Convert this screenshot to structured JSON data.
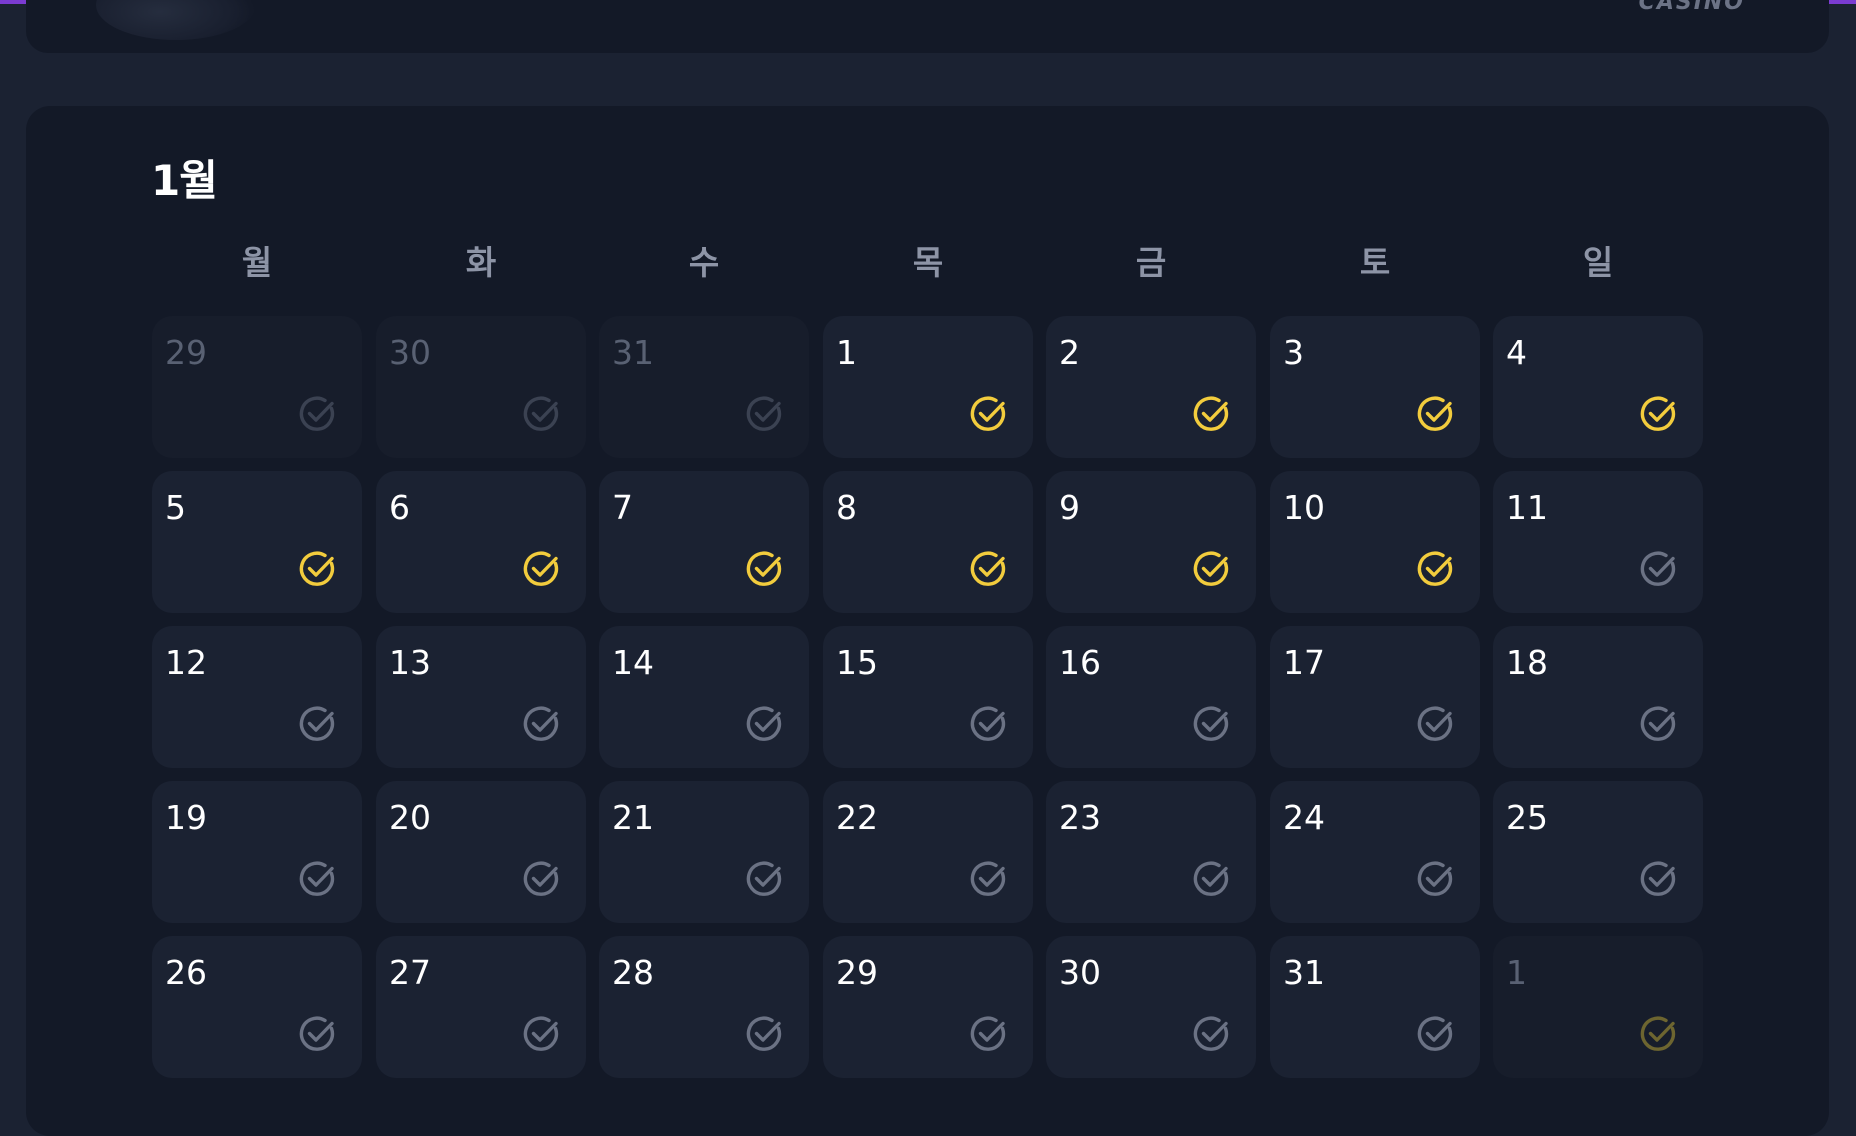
{
  "header": {
    "logo_text": "CASINO"
  },
  "calendar": {
    "month_title": "1월",
    "weekdays": [
      "월",
      "화",
      "수",
      "목",
      "금",
      "토",
      "일"
    ],
    "colors": {
      "checked": "#f2cc3d",
      "unchecked": "#6b7284",
      "muted_checked": "#6d6530",
      "muted_unchecked": "#3b4252"
    },
    "weeks": [
      [
        {
          "day": "29",
          "muted": true,
          "checked": false
        },
        {
          "day": "30",
          "muted": true,
          "checked": false
        },
        {
          "day": "31",
          "muted": true,
          "checked": false
        },
        {
          "day": "1",
          "muted": false,
          "checked": true
        },
        {
          "day": "2",
          "muted": false,
          "checked": true
        },
        {
          "day": "3",
          "muted": false,
          "checked": true
        },
        {
          "day": "4",
          "muted": false,
          "checked": true
        }
      ],
      [
        {
          "day": "5",
          "muted": false,
          "checked": true
        },
        {
          "day": "6",
          "muted": false,
          "checked": true
        },
        {
          "day": "7",
          "muted": false,
          "checked": true
        },
        {
          "day": "8",
          "muted": false,
          "checked": true
        },
        {
          "day": "9",
          "muted": false,
          "checked": true
        },
        {
          "day": "10",
          "muted": false,
          "checked": true
        },
        {
          "day": "11",
          "muted": false,
          "checked": false
        }
      ],
      [
        {
          "day": "12",
          "muted": false,
          "checked": false
        },
        {
          "day": "13",
          "muted": false,
          "checked": false
        },
        {
          "day": "14",
          "muted": false,
          "checked": false
        },
        {
          "day": "15",
          "muted": false,
          "checked": false
        },
        {
          "day": "16",
          "muted": false,
          "checked": false
        },
        {
          "day": "17",
          "muted": false,
          "checked": false
        },
        {
          "day": "18",
          "muted": false,
          "checked": false
        }
      ],
      [
        {
          "day": "19",
          "muted": false,
          "checked": false
        },
        {
          "day": "20",
          "muted": false,
          "checked": false
        },
        {
          "day": "21",
          "muted": false,
          "checked": false
        },
        {
          "day": "22",
          "muted": false,
          "checked": false
        },
        {
          "day": "23",
          "muted": false,
          "checked": false
        },
        {
          "day": "24",
          "muted": false,
          "checked": false
        },
        {
          "day": "25",
          "muted": false,
          "checked": false
        }
      ],
      [
        {
          "day": "26",
          "muted": false,
          "checked": false
        },
        {
          "day": "27",
          "muted": false,
          "checked": false
        },
        {
          "day": "28",
          "muted": false,
          "checked": false
        },
        {
          "day": "29",
          "muted": false,
          "checked": false
        },
        {
          "day": "30",
          "muted": false,
          "checked": false
        },
        {
          "day": "31",
          "muted": false,
          "checked": false
        },
        {
          "day": "1",
          "muted": true,
          "checked": true
        }
      ]
    ]
  }
}
